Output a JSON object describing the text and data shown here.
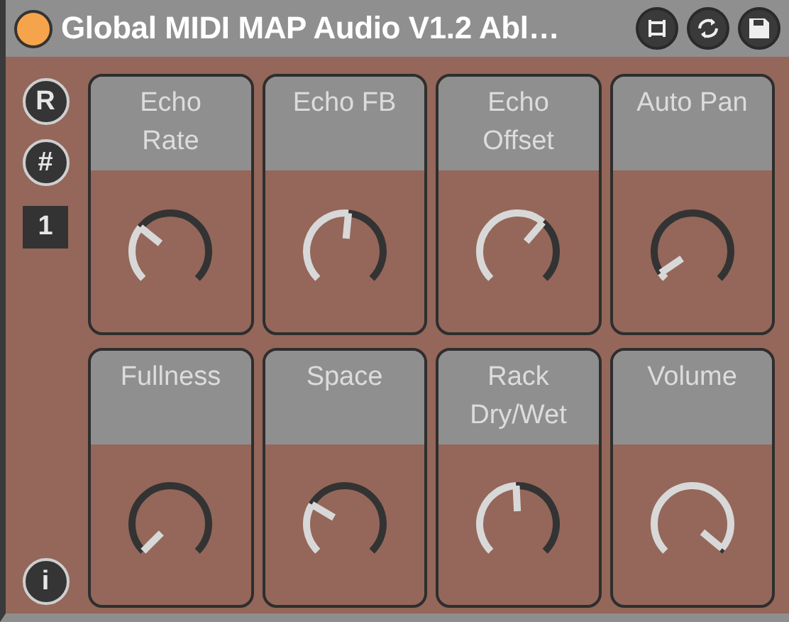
{
  "title_bar": {
    "title": "Global MIDI MAP Audio V1.2 Abl…",
    "active": true
  },
  "side": {
    "record_label": "R",
    "hash_label": "#",
    "channel": "1",
    "info_label": "i"
  },
  "knobs": [
    {
      "label": "Echo Rate"
    },
    {
      "label": "Echo FB"
    },
    {
      "label": "Echo Offset"
    },
    {
      "label": "Auto Pan"
    },
    {
      "label": "Fullness"
    },
    {
      "label": "Space"
    },
    {
      "label": "Rack Dry/Wet"
    },
    {
      "label": "Volume"
    }
  ]
}
